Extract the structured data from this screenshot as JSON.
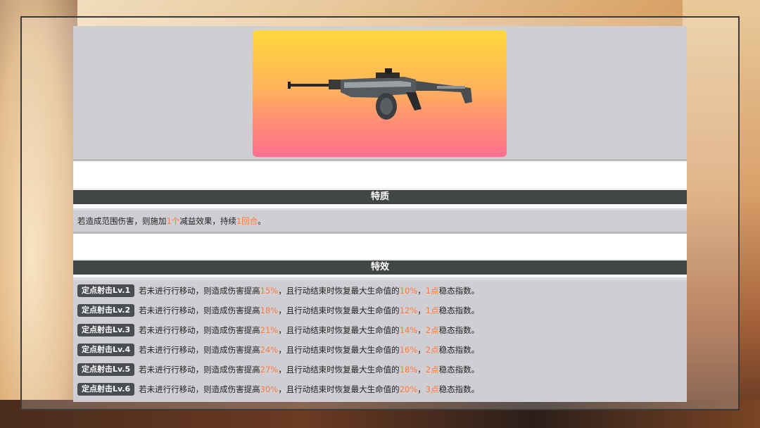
{
  "colors": {
    "header_bg": "#424647",
    "panel_bg": "#cfced3",
    "highlight": "#ff7a3c",
    "badge_bg": "#4a4e52"
  },
  "weapon": {
    "icon": "machine-gun-icon"
  },
  "trait_section": {
    "title": "特质",
    "text_before": "若造成范围伤害，则施加",
    "count": "1个",
    "text_middle": "减益效果，持续",
    "duration": "1回合",
    "text_after": "。"
  },
  "effects_section": {
    "title": "特效",
    "text_a": "若未进行行移动，则造成伤害提高",
    "text_b": "，且行动结束时恢复最大生命值的",
    "text_c": "，",
    "text_d": "稳态指数。",
    "levels": [
      {
        "badge": "定点射击Lv.1",
        "damage": "15%",
        "heal": "10%",
        "points": "1点"
      },
      {
        "badge": "定点射击Lv.2",
        "damage": "18%",
        "heal": "12%",
        "points": "1点"
      },
      {
        "badge": "定点射击Lv.3",
        "damage": "21%",
        "heal": "14%",
        "points": "2点"
      },
      {
        "badge": "定点射击Lv.4",
        "damage": "24%",
        "heal": "16%",
        "points": "2点"
      },
      {
        "badge": "定点射击Lv.5",
        "damage": "27%",
        "heal": "18%",
        "points": "2点"
      },
      {
        "badge": "定点射击Lv.6",
        "damage": "30%",
        "heal": "20%",
        "points": "3点"
      }
    ]
  }
}
